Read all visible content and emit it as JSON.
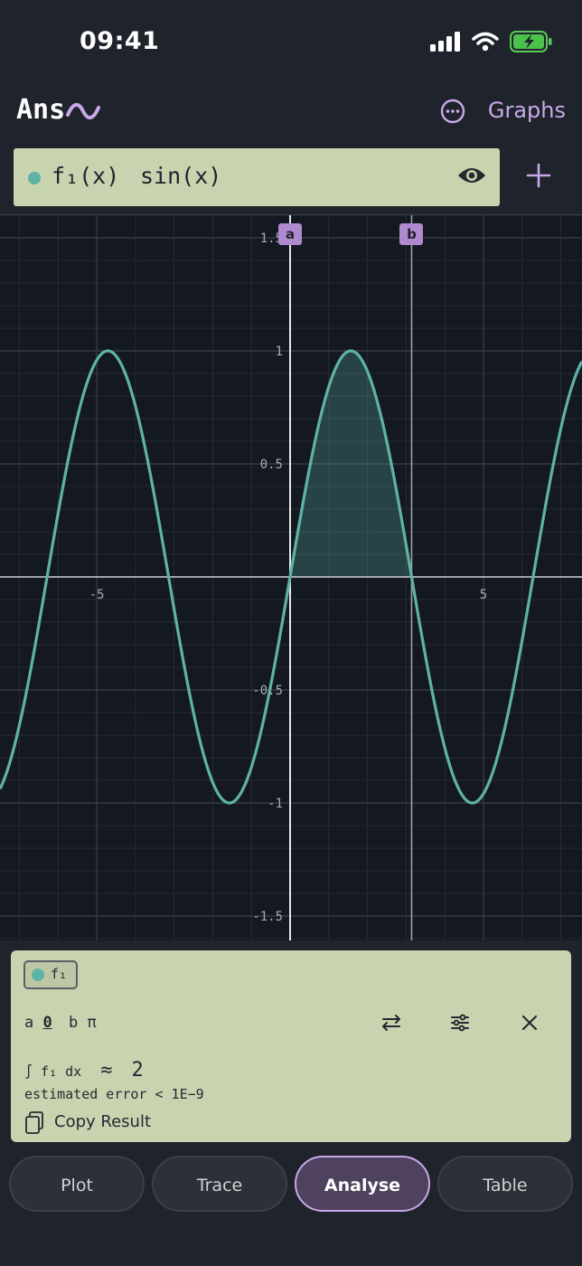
{
  "status_bar": {
    "time": "09:41"
  },
  "header": {
    "app_title": "Ans",
    "graphs_label": "Graphs"
  },
  "function_row": {
    "label": "f₁(x)",
    "expression": "sin(x)",
    "color": "#5eb3a6"
  },
  "graph": {
    "x_ticks": [
      "-5",
      "5"
    ],
    "y_ticks": [
      "1.5",
      "1",
      "0.5",
      "-0.5",
      "-1",
      "-1.5"
    ],
    "marker_a": "a",
    "marker_b": "b",
    "curve_color": "#5eb3a6",
    "shade_from": 0,
    "shade_to": 3.14159
  },
  "analysis": {
    "chip_label": "f₁",
    "a_label": "a",
    "a_value": "0",
    "b_label": "b",
    "b_value": "π",
    "integral_label": "∫ f₁ dx",
    "approx_symbol": "≈",
    "result": "2",
    "error_text": "estimated error < 1E−9",
    "copy_label": "Copy Result"
  },
  "tabs": [
    {
      "label": "Plot",
      "active": false
    },
    {
      "label": "Trace",
      "active": false
    },
    {
      "label": "Analyse",
      "active": true
    },
    {
      "label": "Table",
      "active": false
    }
  ],
  "colors": {
    "accent": "#c9a8e8",
    "panel": "#c8d3b0",
    "background": "#1f232b",
    "plot_bg": "#141820"
  }
}
